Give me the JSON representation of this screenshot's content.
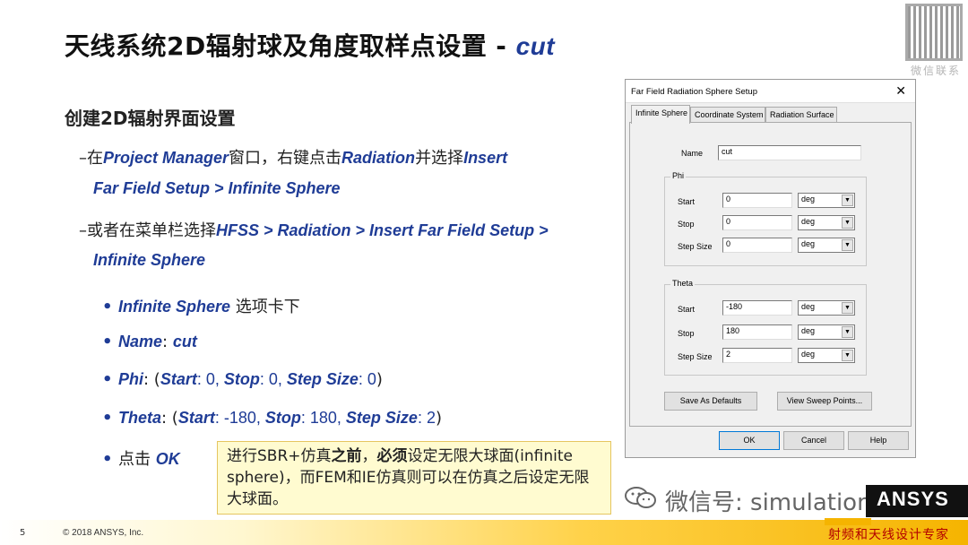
{
  "title": {
    "main": "天线系统2D辐射球及角度取样点设置",
    "sep": "-",
    "kw": "cut"
  },
  "qr": {
    "label": "微信联系"
  },
  "subtitle": "创建2D辐射界面设置",
  "lines": {
    "l1": {
      "prefix": "–在",
      "kw1": "Project Manager",
      "mid": "窗口，右键点击",
      "kw2": "Radiation",
      "mid2": "并选择",
      "kw3": "Insert"
    },
    "l2": {
      "kw": "Far Field Setup > Infinite Sphere"
    },
    "l3": {
      "prefix": "–或者在菜单栏选择",
      "kw1": "HFSS",
      "kw2": " > Radiation > Insert Far Field Setup >"
    },
    "l4": {
      "kw": "Infinite Sphere"
    }
  },
  "bullets": {
    "b1": {
      "kw": "Infinite Sphere",
      "rest": " 选项卡下"
    },
    "b2": {
      "kw": "Name",
      "colon": ": ",
      "val": "cut"
    },
    "b3": {
      "kw": "Phi",
      "t1": ": (",
      "k1": "Start",
      "v1": ": 0, ",
      "k2": "Stop",
      "v2": ": 0, ",
      "k3": "Step Size",
      "v3": ": 0",
      "end": ")"
    },
    "b4": {
      "kw": "Theta",
      "t1": ": (",
      "k1": "Start",
      "v1": ": -180, ",
      "k2": "Stop",
      "v2": ": 180, ",
      "k3": "Step Size",
      "v3": ": 2",
      "end": ")"
    },
    "b5": {
      "pre": "点击 ",
      "kw": "OK"
    }
  },
  "note": {
    "p1": "进行SBR+仿真",
    "b1": "之前",
    "p2": "，",
    "b2": "必须",
    "p3": "设定无限大球面(infinite sphere)，而FEM和IE仿真则可以在仿真之后设定无限大球面。"
  },
  "dialog": {
    "title": "Far Field Radiation Sphere Setup",
    "close": "✕",
    "tabs": [
      "Infinite Sphere",
      "Coordinate System",
      "Radiation Surface"
    ],
    "name_label": "Name",
    "name_value": "cut",
    "phi": {
      "title": "Phi",
      "start_label": "Start",
      "start": "0",
      "stop_label": "Stop",
      "stop": "0",
      "step_label": "Step Size",
      "step": "0",
      "unit": "deg"
    },
    "theta": {
      "title": "Theta",
      "start_label": "Start",
      "start": "-180",
      "stop_label": "Stop",
      "stop": "180",
      "step_label": "Step Size",
      "step": "2",
      "unit": "deg"
    },
    "buttons": {
      "save_defaults": "Save As Defaults",
      "view_sweep": "View Sweep Points...",
      "ok": "OK",
      "cancel": "Cancel",
      "help": "Help"
    }
  },
  "footer": {
    "page": "5",
    "copyright": "© 2018  ANSYS, Inc."
  },
  "watermark": {
    "wechat": "微信号: simulation",
    "brand": "ANSYS",
    "stamp": "射频和天线设计专家"
  }
}
